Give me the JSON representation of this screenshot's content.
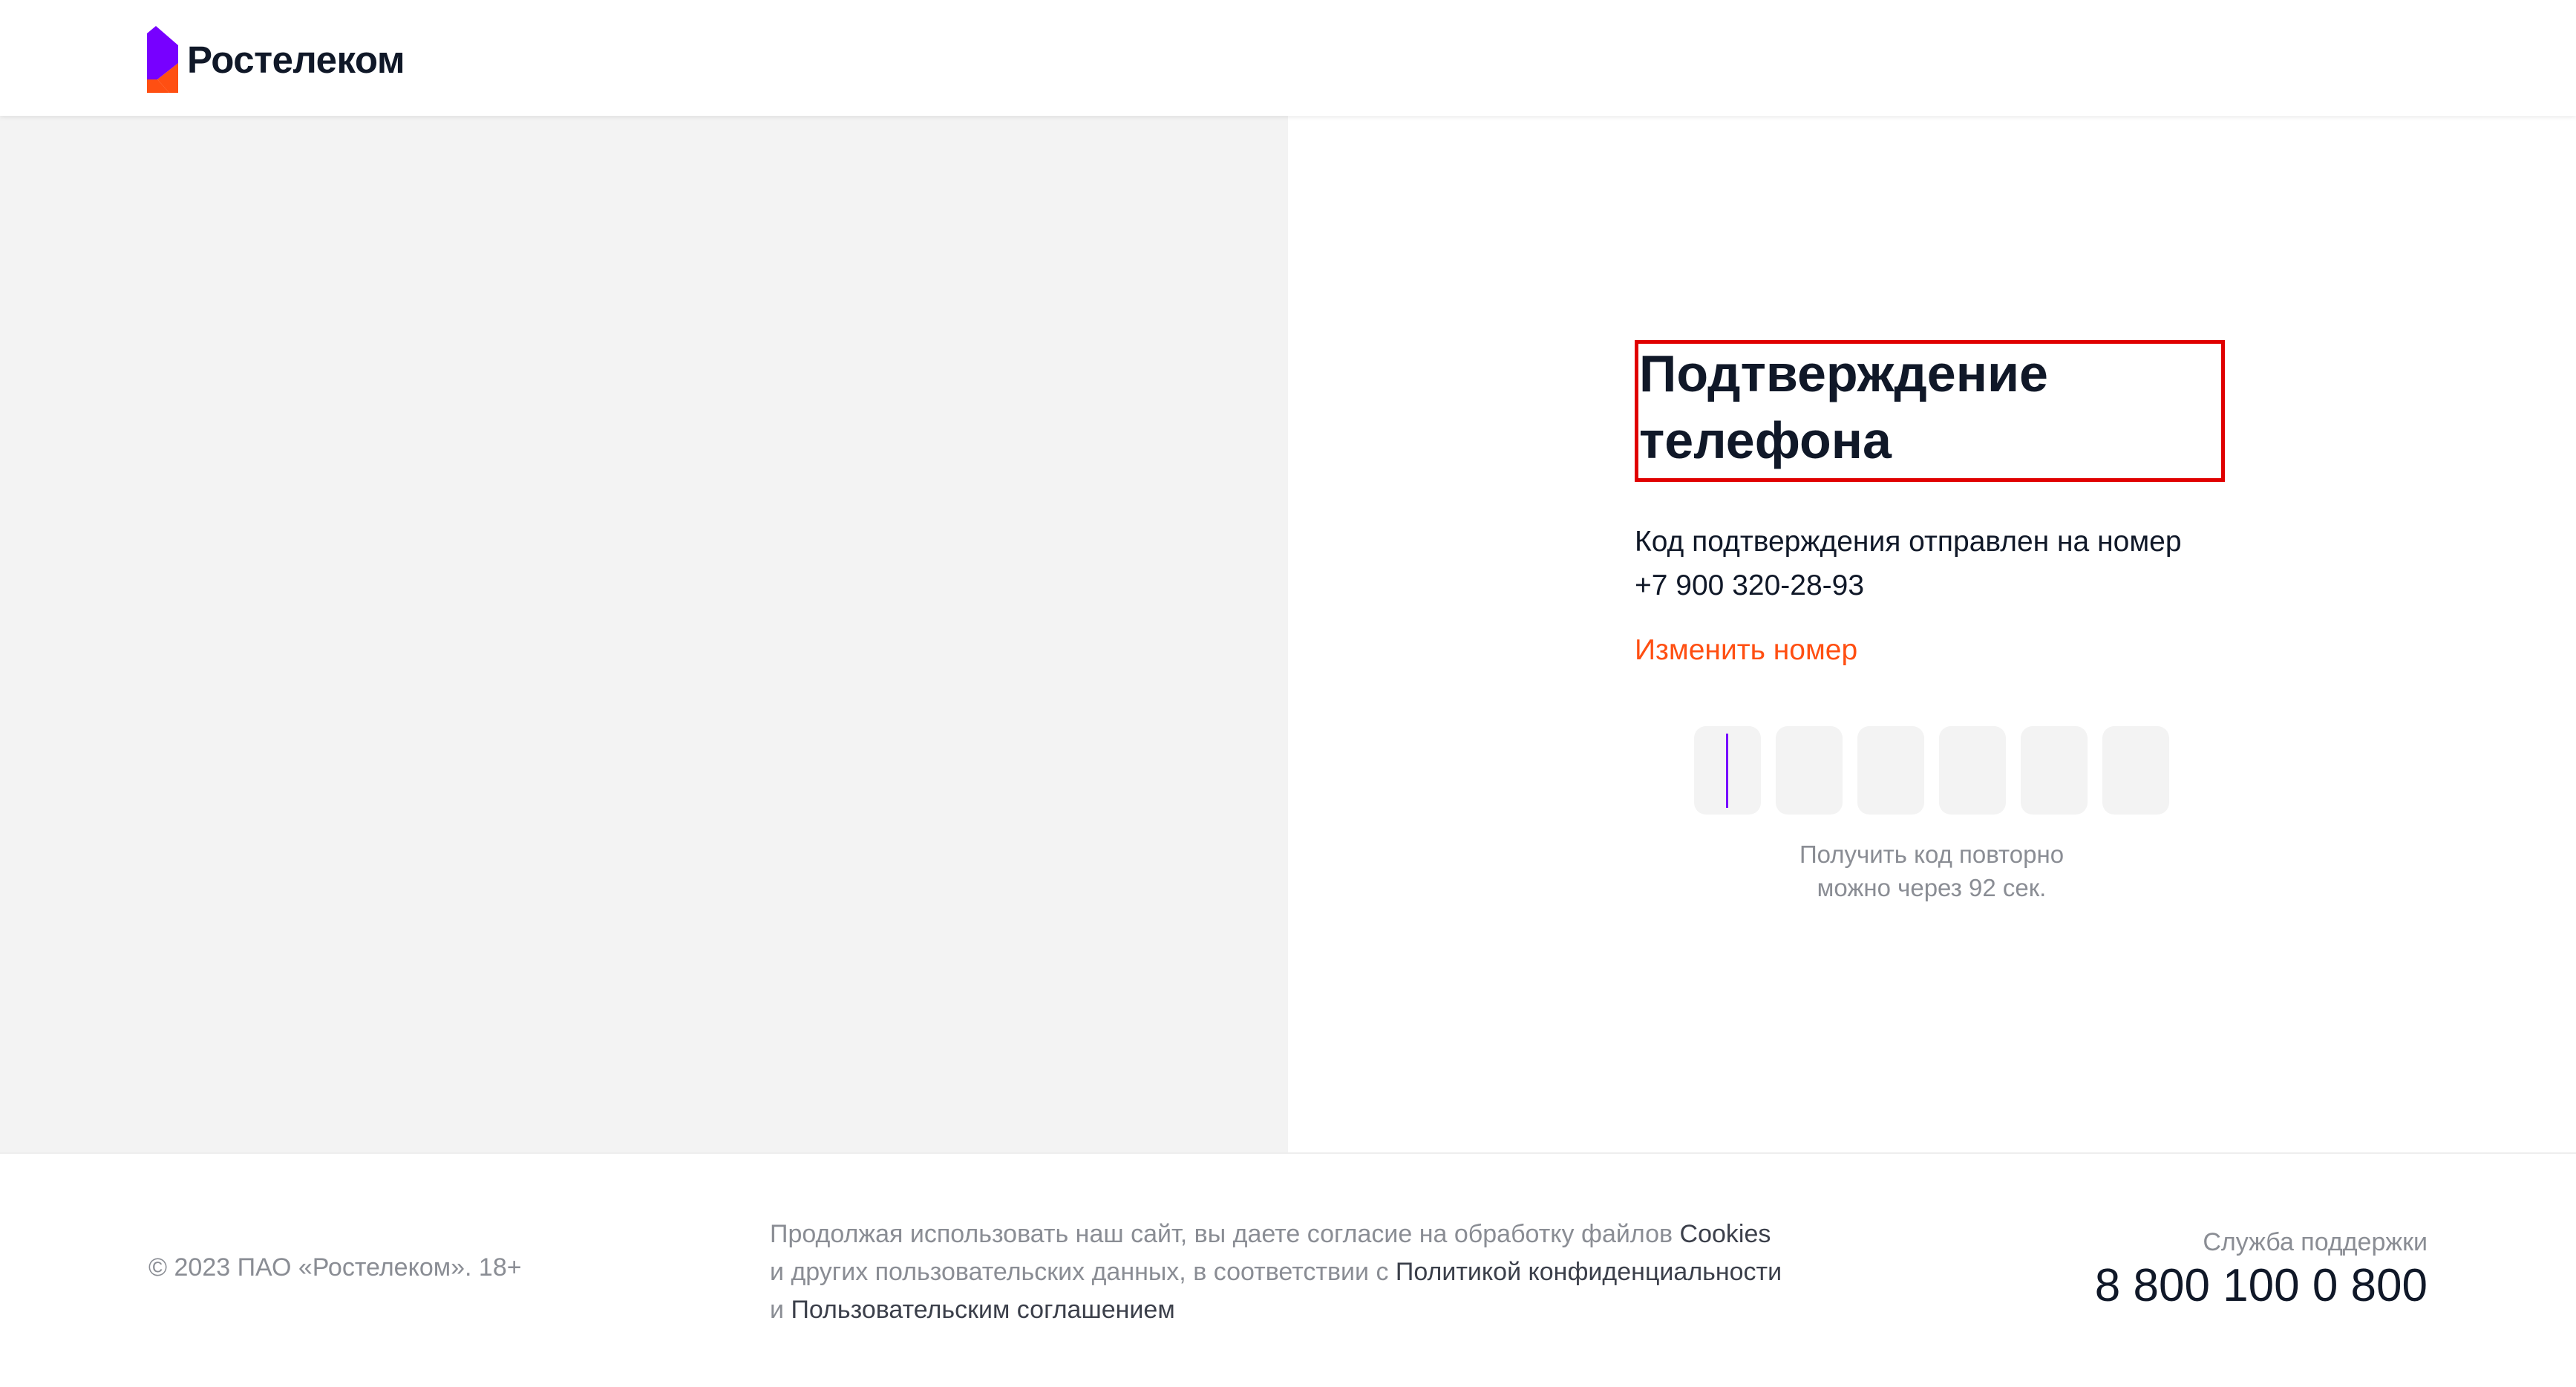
{
  "header": {
    "logo_text": "Ростелеком",
    "logo_icon": "rostelecom-logo-icon",
    "brand_colors": {
      "purple": "#7700ff",
      "orange": "#ff4f12"
    }
  },
  "confirm": {
    "title": "Подтверждение телефона",
    "sent_text": "Код подтверждения отправлен на номер",
    "phone": "+7 900 320-28-93",
    "change_link": "Изменить номер",
    "code_cells": [
      "",
      "",
      "",
      "",
      "",
      ""
    ],
    "resend_line1": "Получить код повторно",
    "resend_line2": "можно через 92 сек."
  },
  "footer": {
    "copyright": "© 2023 ПАО «Ростелеком». 18+",
    "consent_part1": "Продолжая использовать наш сайт, вы даете согласие на обработку файлов",
    "cookies_link": "Cookies",
    "consent_part2": "и других пользовательских данных, в соответствии с",
    "privacy_link": "Политикой конфиденциальности",
    "consent_part3": "и",
    "terms_link": "Пользовательским соглашением",
    "support_label": "Служба поддержки",
    "support_phone": "8 800 100 0 800"
  }
}
